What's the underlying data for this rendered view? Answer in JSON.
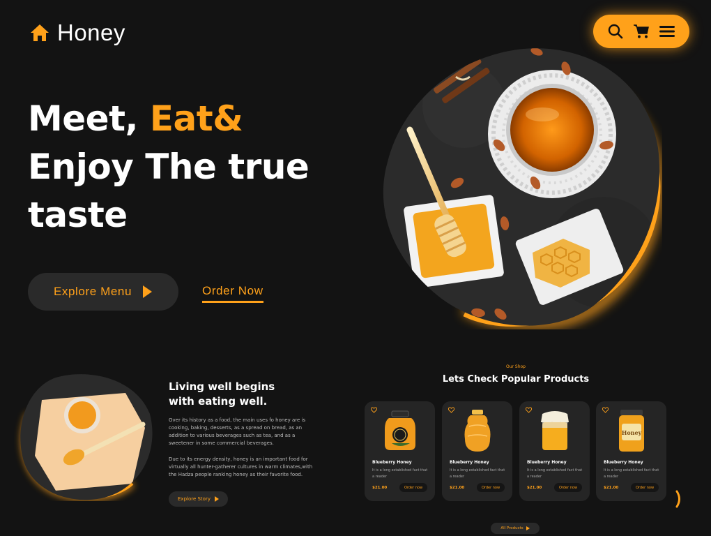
{
  "brand": {
    "name": "Honey",
    "accent": "#ffa11a",
    "background": "#131313"
  },
  "nav": {
    "icons": [
      "search-icon",
      "cart-icon",
      "menu-icon"
    ]
  },
  "hero": {
    "title_line1": "Meet, ",
    "title_accent": "Eat&",
    "title_line2": "Enjoy The true",
    "title_line3": "taste",
    "explore_label": "Explore Menu",
    "order_label": "Order Now"
  },
  "story": {
    "title_line1": "Living well begins",
    "title_line2": "with eating well.",
    "p1": "Over its history as a food, the main uses fo honey are is cooking, baking, desserts, as a spread on bread, as an addition to various beverages such as tea, and as a sweetener in some commercial beverages.",
    "p2": "Due to its energy density, honey is an important food for virtually all hunter-gatherer cultures in warm climates,with the Hadza people ranking honey as their favorite food.",
    "button_label": "Explore Story"
  },
  "shop": {
    "kicker": "Our Shop",
    "title": "Lets Check Popular Products",
    "all_label": "All Products",
    "products": [
      {
        "name": "Blueberry Honey",
        "desc": "It is a long established fact that a reader",
        "price": "$21.00",
        "order": "Order now"
      },
      {
        "name": "Blueberry Honey",
        "desc": "It is a long established fact that a reader",
        "price": "$21.00",
        "order": "Order now"
      },
      {
        "name": "Blueberry Honey",
        "desc": "It is a long established fact that a reader",
        "price": "$21.00",
        "order": "Order now"
      },
      {
        "name": "Blueberry Honey",
        "desc": "It is a long established fact that a reader",
        "price": "$21.00",
        "order": "Order now"
      }
    ],
    "jar_label": "Honey"
  }
}
